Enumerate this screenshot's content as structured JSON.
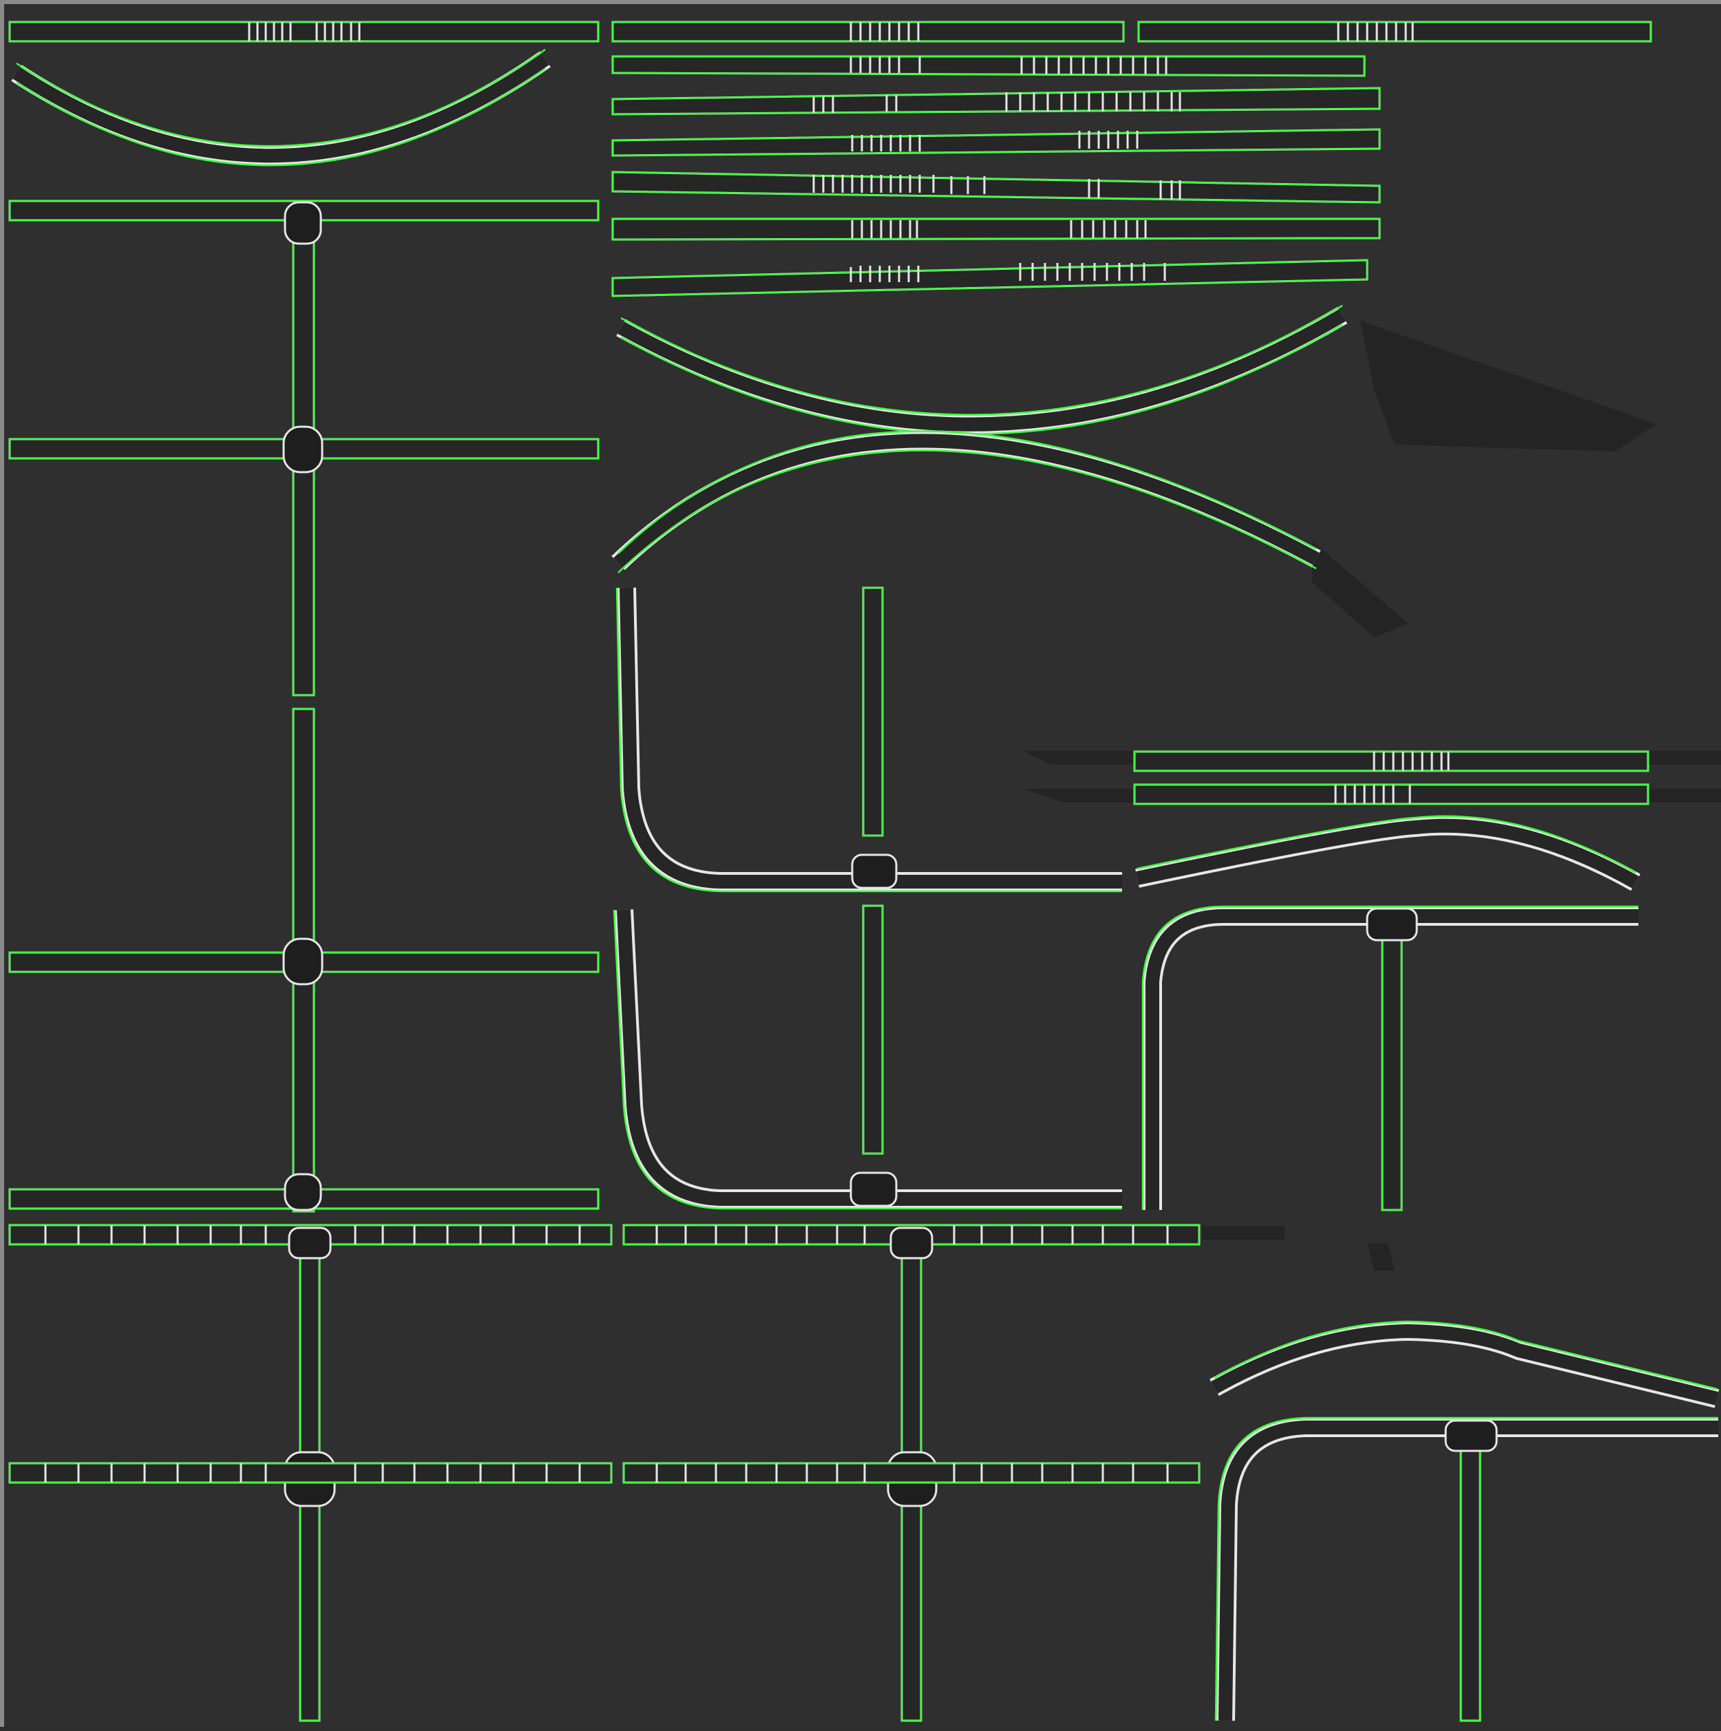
{
  "viewport": {
    "background": "#2f2f2f",
    "frame_color": "#8a8a8a",
    "shell_color": "#e6e6e6",
    "seam_color": "#3cff3c",
    "fill_color": "#262626"
  },
  "uv_islands": {
    "straight_strips": 14,
    "curved_strips": 5,
    "corner_pieces": 4,
    "t_junctions": 6,
    "cross_junctions": 5
  }
}
